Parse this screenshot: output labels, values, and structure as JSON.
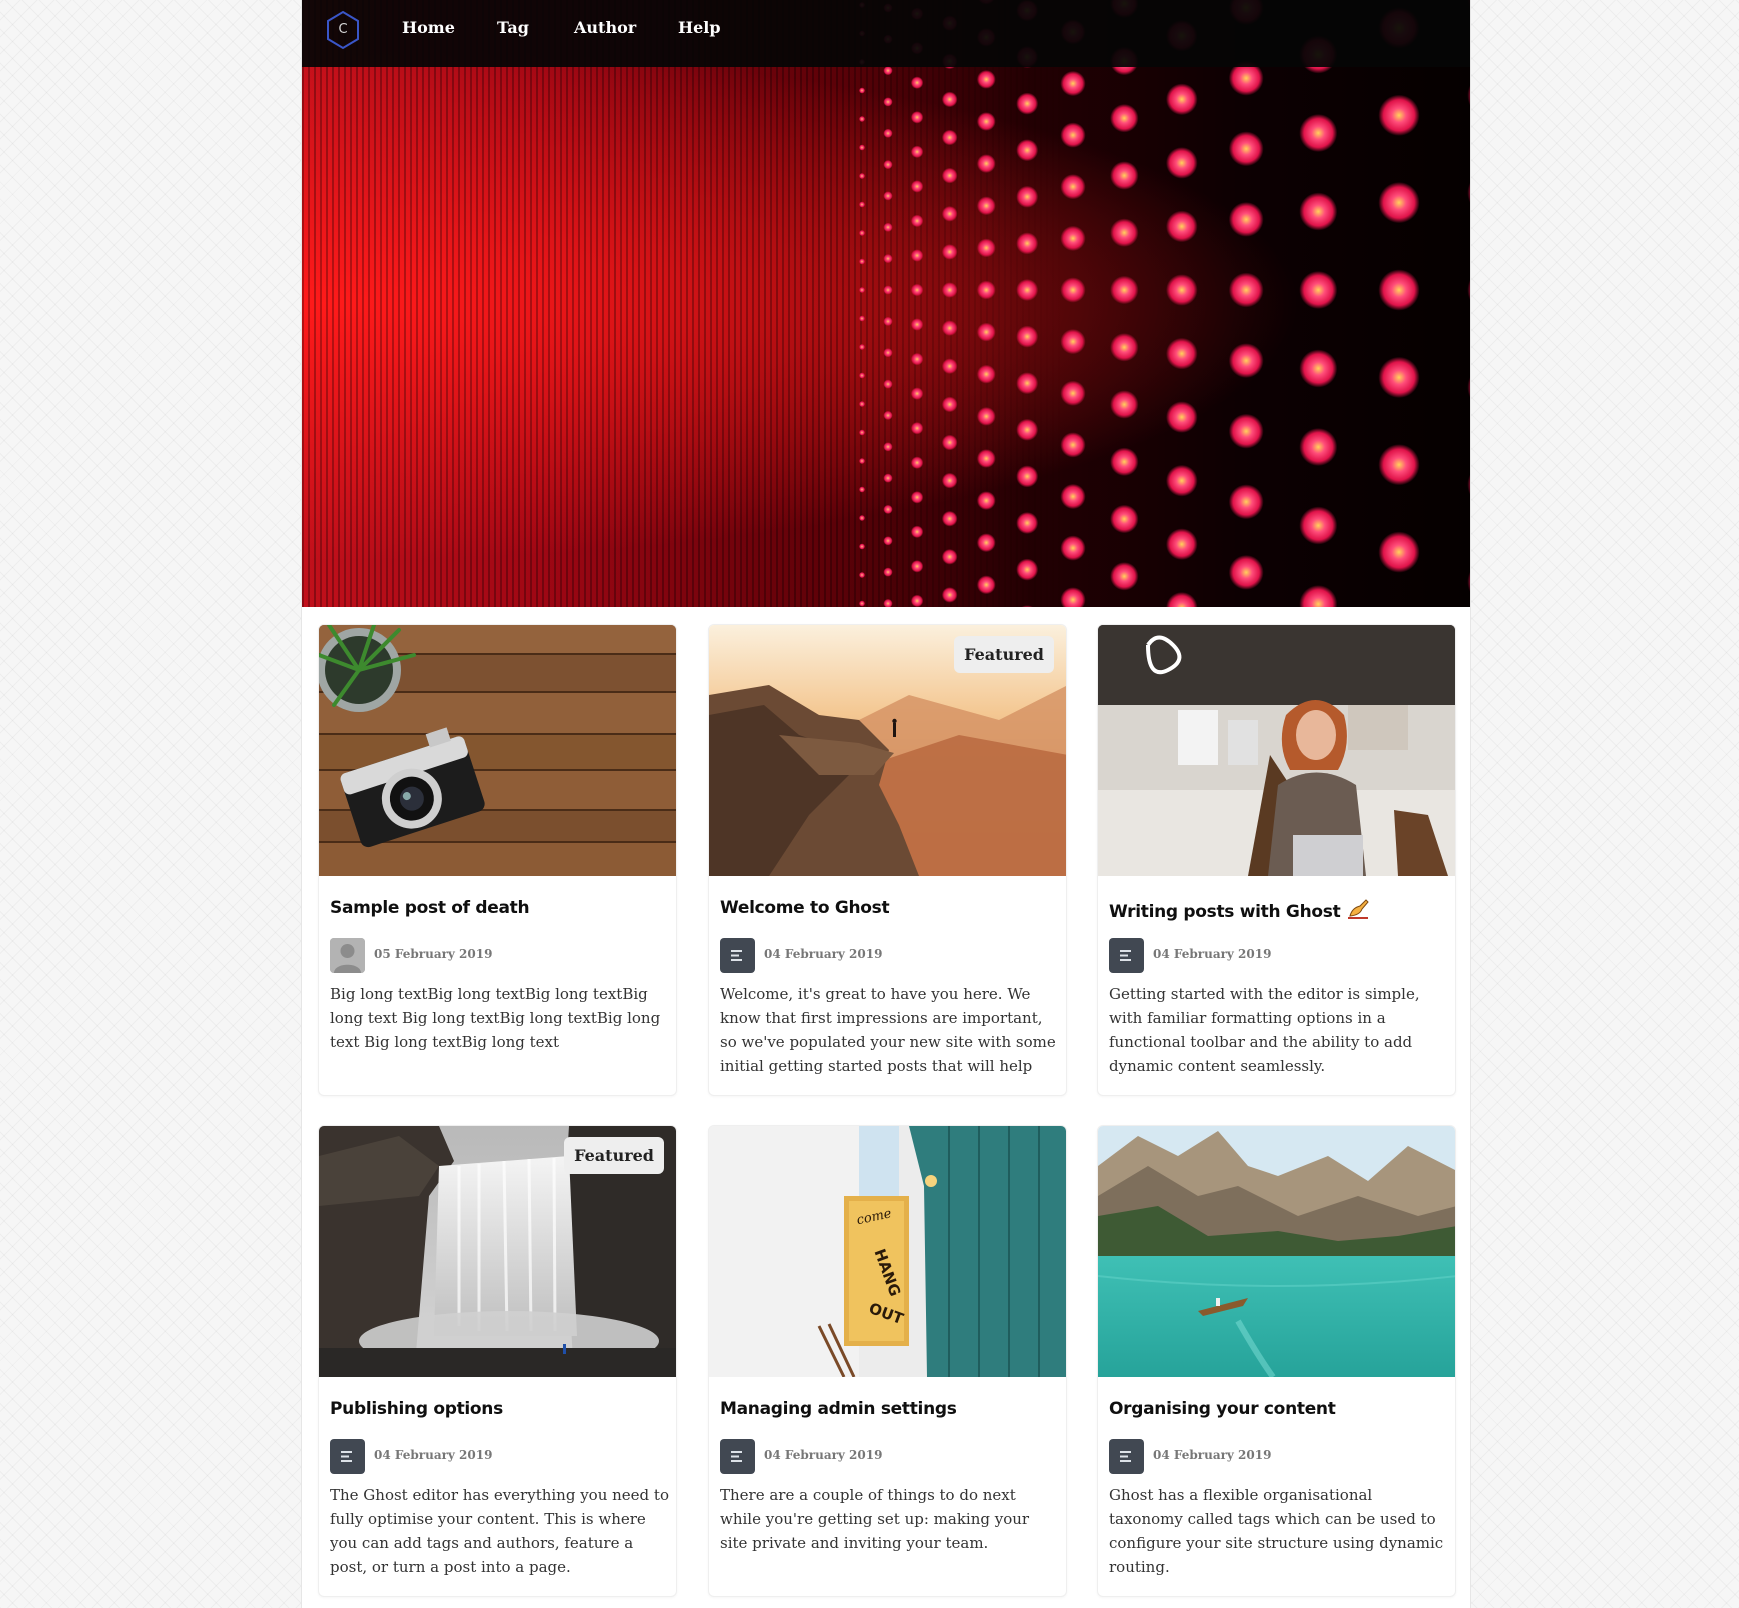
{
  "nav": {
    "logo_letter": "C",
    "items": [
      {
        "label": "Home"
      },
      {
        "label": "Tag"
      },
      {
        "label": "Author"
      },
      {
        "label": "Help"
      }
    ]
  },
  "posts": [
    {
      "title": "Sample post of death",
      "date": "05 February 2019",
      "excerpt": "Big long textBig long textBig long textBig long text Big long textBig long textBig long text Big long textBig long text",
      "badge": "",
      "avatar": "author-photo",
      "image": "camera-on-wood"
    },
    {
      "title": "Welcome to Ghost",
      "date": "04 February 2019",
      "excerpt": "Welcome, it's great to have you here. We know that first impressions are important, so we've populated your new site with some initial getting started posts that will help you get",
      "badge": "Featured",
      "avatar": "document-icon",
      "image": "cliff-at-sunset"
    },
    {
      "title": "Writing posts with Ghost",
      "title_emoji": "writing-hand-icon",
      "date": "04 February 2019",
      "excerpt": "Getting started with the editor is simple, with familiar formatting options in a functional toolbar and the ability to add dynamic content seamlessly.",
      "badge": "",
      "avatar": "document-icon",
      "image": "woman-in-cafe"
    },
    {
      "title": "Publishing options",
      "date": "04 February 2019",
      "excerpt": "The Ghost editor has everything you need to fully optimise your content. This is where you can add tags and authors, feature a post, or turn a post into a page.",
      "badge": "Featured",
      "avatar": "document-icon",
      "image": "waterfall"
    },
    {
      "title": "Managing admin settings",
      "date": "04 February 2019",
      "excerpt": "There are a couple of things to do next while you're getting set up: making your site private and inviting your team.",
      "badge": "",
      "avatar": "document-icon",
      "image": "come-hang-out-sign",
      "image_text": [
        "come",
        "HANG",
        "OUT"
      ]
    },
    {
      "title": "Organising your content",
      "date": "04 February 2019",
      "excerpt": "Ghost has a flexible organisational taxonomy called tags which can be used to configure your site structure using dynamic routing.",
      "badge": "",
      "avatar": "document-icon",
      "image": "mountain-lake-boat"
    }
  ]
}
